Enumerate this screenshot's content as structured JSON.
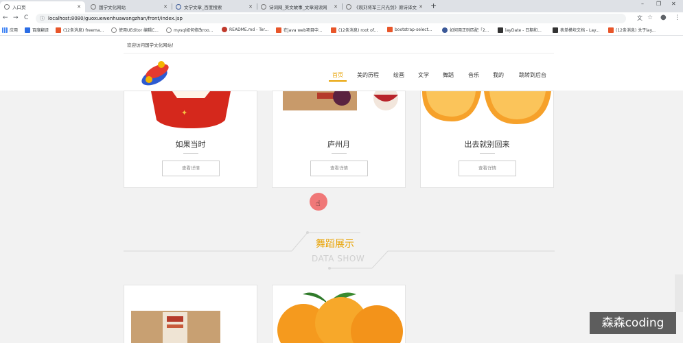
{
  "browser": {
    "tabs": [
      {
        "title": "入口页",
        "active": true
      },
      {
        "title": "国学文化网站",
        "active": false
      },
      {
        "title": "文学文章_百度搜索",
        "active": false
      },
      {
        "title": "诗词网_美文故事_文章阅读网",
        "active": false
      },
      {
        "title": "《观刘将军三尺光剑》原诗译文",
        "active": false
      }
    ],
    "new_tab_label": "+",
    "window_buttons": {
      "minimize": "–",
      "restore": "❐",
      "close": "✕"
    },
    "nav": {
      "back": "←",
      "forward": "→",
      "reload": "C"
    },
    "url": "localhost:8080/guoxuewenhuawangzhan/front/index.jsp",
    "bookmarks": [
      {
        "label": "应用",
        "color": "#4285f4"
      },
      {
        "label": "百度翻译",
        "color": "#2b6de5"
      },
      {
        "label": "(12条消息) freema...",
        "color": "#e8562a"
      },
      {
        "label": "使用UEditor 编辑C...",
        "color": "#888888"
      },
      {
        "label": "mysql如何修改roo...",
        "color": "#888888"
      },
      {
        "label": "README.md - Ter...",
        "color": "#c0392b"
      },
      {
        "label": "在java web项目中...",
        "color": "#e8562a"
      },
      {
        "label": "(12条消息) root of...",
        "color": "#e8562a"
      },
      {
        "label": "bootstrap-select...",
        "color": "#e8562a"
      },
      {
        "label": "如何用正则匹配「2...",
        "color": "#3b5998"
      },
      {
        "label": "layDate - 日期和...",
        "color": "#333333"
      },
      {
        "label": "表单模块文档 - Lay...",
        "color": "#333333"
      },
      {
        "label": "(12条消息) 关于lay...",
        "color": "#e8562a"
      }
    ]
  },
  "site": {
    "welcome": "欢迎访问国学文化网站！",
    "nav": [
      "首页",
      "美的历程",
      "绘画",
      "文学",
      "舞蹈",
      "音乐",
      "我的",
      "跳转到后台"
    ],
    "active_nav": "首页",
    "accent": "#e8a200"
  },
  "cards_row1": [
    {
      "title": "如果当时",
      "button": "查看详情"
    },
    {
      "title": "庐州月",
      "button": "查看详情"
    },
    {
      "title": "出去就别回来",
      "button": "查看详情"
    }
  ],
  "section": {
    "title": "舞蹈展示",
    "subtitle": "DATA SHOW"
  },
  "watermark": "森森coding"
}
